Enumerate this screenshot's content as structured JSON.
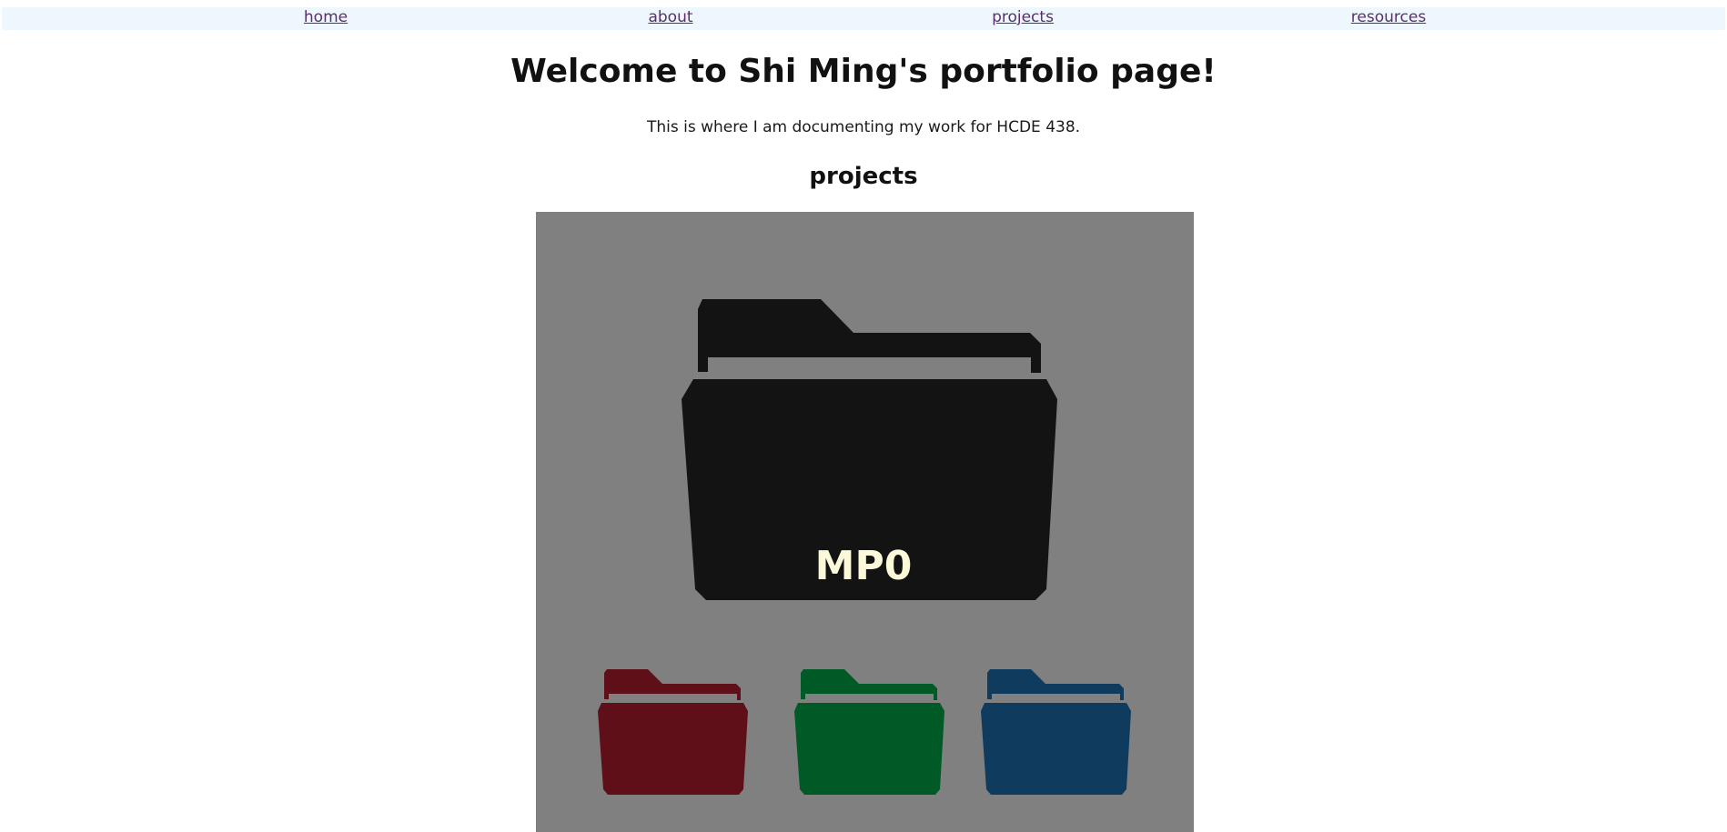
{
  "nav": {
    "items": [
      {
        "label": "home"
      },
      {
        "label": "about"
      },
      {
        "label": "projects"
      },
      {
        "label": "resources"
      }
    ]
  },
  "header": {
    "title": "Welcome to Shi Ming's portfolio page!",
    "subtitle": "This is where I am documenting my work for HCDE 438."
  },
  "projects": {
    "heading": "projects",
    "main_folder": {
      "label": "MP0",
      "icon": "folder-icon",
      "color": "#141314"
    },
    "folders": [
      {
        "icon": "folder-icon",
        "color": "#5e0f18"
      },
      {
        "icon": "folder-icon",
        "color": "#005a26"
      },
      {
        "icon": "folder-icon",
        "color": "#0e3b5e"
      }
    ],
    "panel_color": "#808080",
    "label_color": "#fcf8da"
  }
}
